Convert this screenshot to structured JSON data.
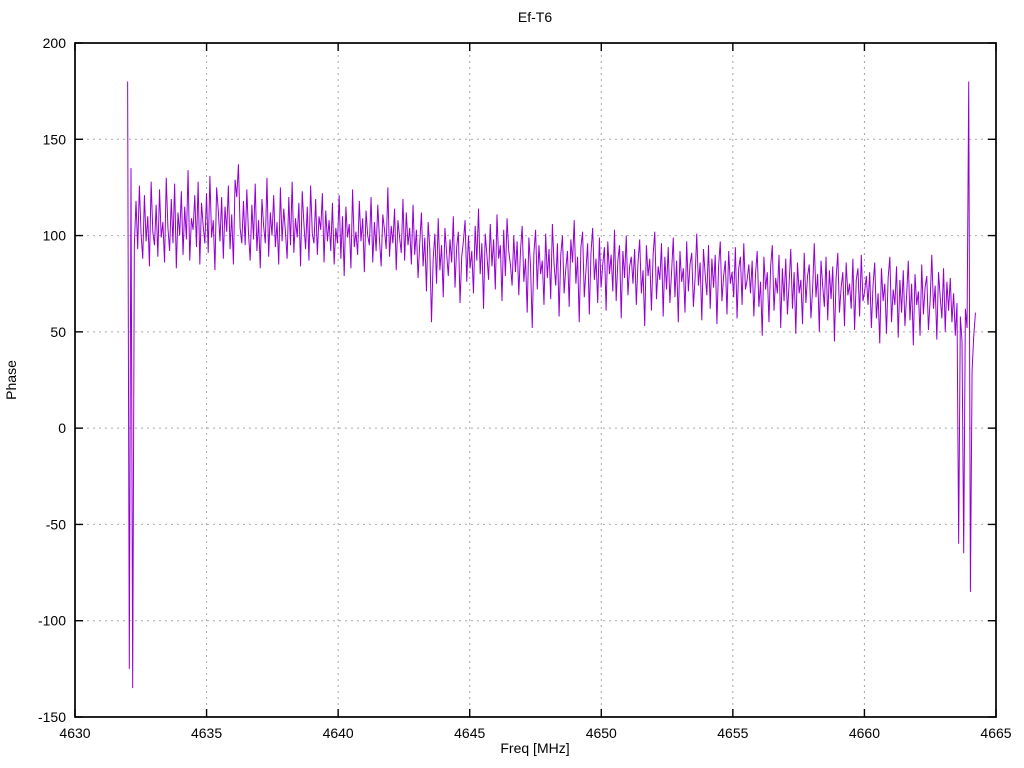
{
  "window": {
    "title": "Ef-T6"
  },
  "chart_data": {
    "type": "line",
    "title": "Ef-T6",
    "xlabel": "Freq [MHz]",
    "ylabel": "Phase",
    "xlim": [
      4630,
      4665
    ],
    "ylim": [
      -150,
      200
    ],
    "xticks": [
      4630,
      4635,
      4640,
      4645,
      4650,
      4655,
      4660,
      4665
    ],
    "yticks": [
      -150,
      -100,
      -50,
      0,
      50,
      100,
      150,
      200
    ],
    "grid": true,
    "grid_style": "dashed",
    "legend_position": "none",
    "line_color": "#9400d3",
    "grid_color": "#a8a8a8",
    "border_color": "#000000",
    "background_color": "#ffffff",
    "series": [
      {
        "name": "phase",
        "x_start": 4632.0,
        "x_step": 0.0638,
        "y": [
          180,
          -125,
          135,
          -135,
          95,
          118,
          93,
          126,
          101,
          88,
          121,
          97,
          110,
          84,
          128,
          102,
          95,
          116,
          89,
          124,
          99,
          107,
          86,
          130,
          104,
          92,
          119,
          96,
          127,
          83,
          112,
          100,
          123,
          90,
          115,
          98,
          134,
          87,
          109,
          103,
          121,
          94,
          128,
          85,
          117,
          105,
          96,
          122,
          91,
          131,
          99,
          108,
          82,
          125,
          113,
          97,
          120,
          88,
          115,
          102,
          126,
          93,
          111,
          85,
          129,
          120,
          137,
          104,
          96,
          118,
          95,
          124,
          101,
          87,
          116,
          98,
          127,
          92,
          108,
          83,
          119,
          105,
          96,
          130,
          89,
          112,
          100,
          121,
          94,
          107,
          85,
          125,
          97,
          114,
          102,
          88,
          120,
          95,
          128,
          91,
          109,
          99,
          117,
          84,
          123,
          106,
          93,
          115,
          87,
          126,
          101,
          96,
          119,
          90,
          110,
          103,
          122,
          86,
          113,
          97,
          108,
          92,
          117,
          85,
          104,
          96,
          121,
          88,
          110,
          79,
          115,
          99,
          106,
          83,
          124,
          94,
          102,
          90,
          118,
          97,
          109,
          81,
          113,
          100,
          95,
          120,
          86,
          107,
          92,
          116,
          98,
          84,
          111,
          103,
          93,
          125,
          89,
          105,
          96,
          114,
          82,
          108,
          99,
          91,
          119,
          87,
          112,
          95,
          104,
          85,
          116,
          90,
          103,
          78,
          96,
          112,
          84,
          99,
          71,
          107,
          93,
          55,
          88,
          101,
          75,
          109,
          82,
          95,
          68,
          104,
          91,
          79,
          98,
          86,
          110,
          73,
          94,
          102,
          65,
          89,
          97,
          108,
          76,
          100,
          83,
          92,
          70,
          105,
          87,
          114,
          80,
          96,
          62,
          101,
          90,
          77,
          106,
          84,
          98,
          72,
          111,
          88,
          95,
          66,
          103,
          79,
          109,
          92,
          85,
          74,
          100,
          81,
          97,
          69,
          92,
          105,
          76,
          88,
          60,
          99,
          84,
          52,
          91,
          103,
          72,
          95,
          80,
          87,
          64,
          101,
          78,
          93,
          67,
          106,
          85,
          74,
          96,
          58,
          90,
          100,
          70,
          83,
          92,
          63,
          98,
          86,
          108,
          75,
          89,
          55,
          94,
          102,
          68,
          82,
          96,
          59,
          91,
          104,
          77,
          88,
          65,
          99,
          73,
          85,
          94,
          61,
          97,
          80,
          90,
          71,
          103,
          66,
          87,
          95,
          57,
          92,
          78,
          100,
          69,
          84,
          89,
          75,
          93,
          64,
          86,
          98,
          70,
          82,
          53,
          95,
          79,
          88,
          61,
          90,
          102,
          67,
          84,
          77,
          96,
          58,
          89,
          72,
          94,
          65,
          81,
          99,
          68,
          87,
          55,
          92,
          76,
          83,
          60,
          97,
          71,
          85,
          91,
          63,
          78,
          101,
          74,
          86,
          56,
          93,
          80,
          69,
          95,
          62,
          88,
          73,
          90,
          54,
          84,
          97,
          66,
          79,
          87,
          59,
          92,
          75,
          81,
          68,
          94,
          57,
          83,
          89,
          64,
          96,
          72,
          77,
          85,
          70,
          87,
          58,
          80,
          92,
          63,
          76,
          48,
          89,
          72,
          81,
          55,
          84,
          95,
          61,
          78,
          70,
          90,
          52,
          83,
          66,
          88,
          59,
          75,
          93,
          62,
          81,
          49,
          86,
          70,
          77,
          54,
          91,
          65,
          79,
          85,
          57,
          72,
          96,
          68,
          80,
          50,
          87,
          74,
          63,
          89,
          56,
          82,
          67,
          84,
          45,
          78,
          91,
          60,
          73,
          81,
          53,
          86,
          69,
          75,
          62,
          88,
          51,
          77,
          83,
          58,
          90,
          66,
          71,
          79,
          64,
          81,
          52,
          74,
          86,
          57,
          70,
          44,
          83,
          66,
          75,
          49,
          78,
          89,
          55,
          72,
          64,
          84,
          47,
          77,
          60,
          82,
          53,
          69,
          87,
          56,
          75,
          43,
          80,
          64,
          71,
          48,
          85,
          59,
          73,
          79,
          51,
          66,
          90,
          62,
          74,
          46,
          81,
          68,
          57,
          83,
          50,
          76,
          61,
          78,
          55,
          70,
          48,
          65,
          -60,
          58,
          45,
          -65,
          62,
          52,
          180,
          -85,
          30,
          48,
          60
        ]
      }
    ]
  }
}
